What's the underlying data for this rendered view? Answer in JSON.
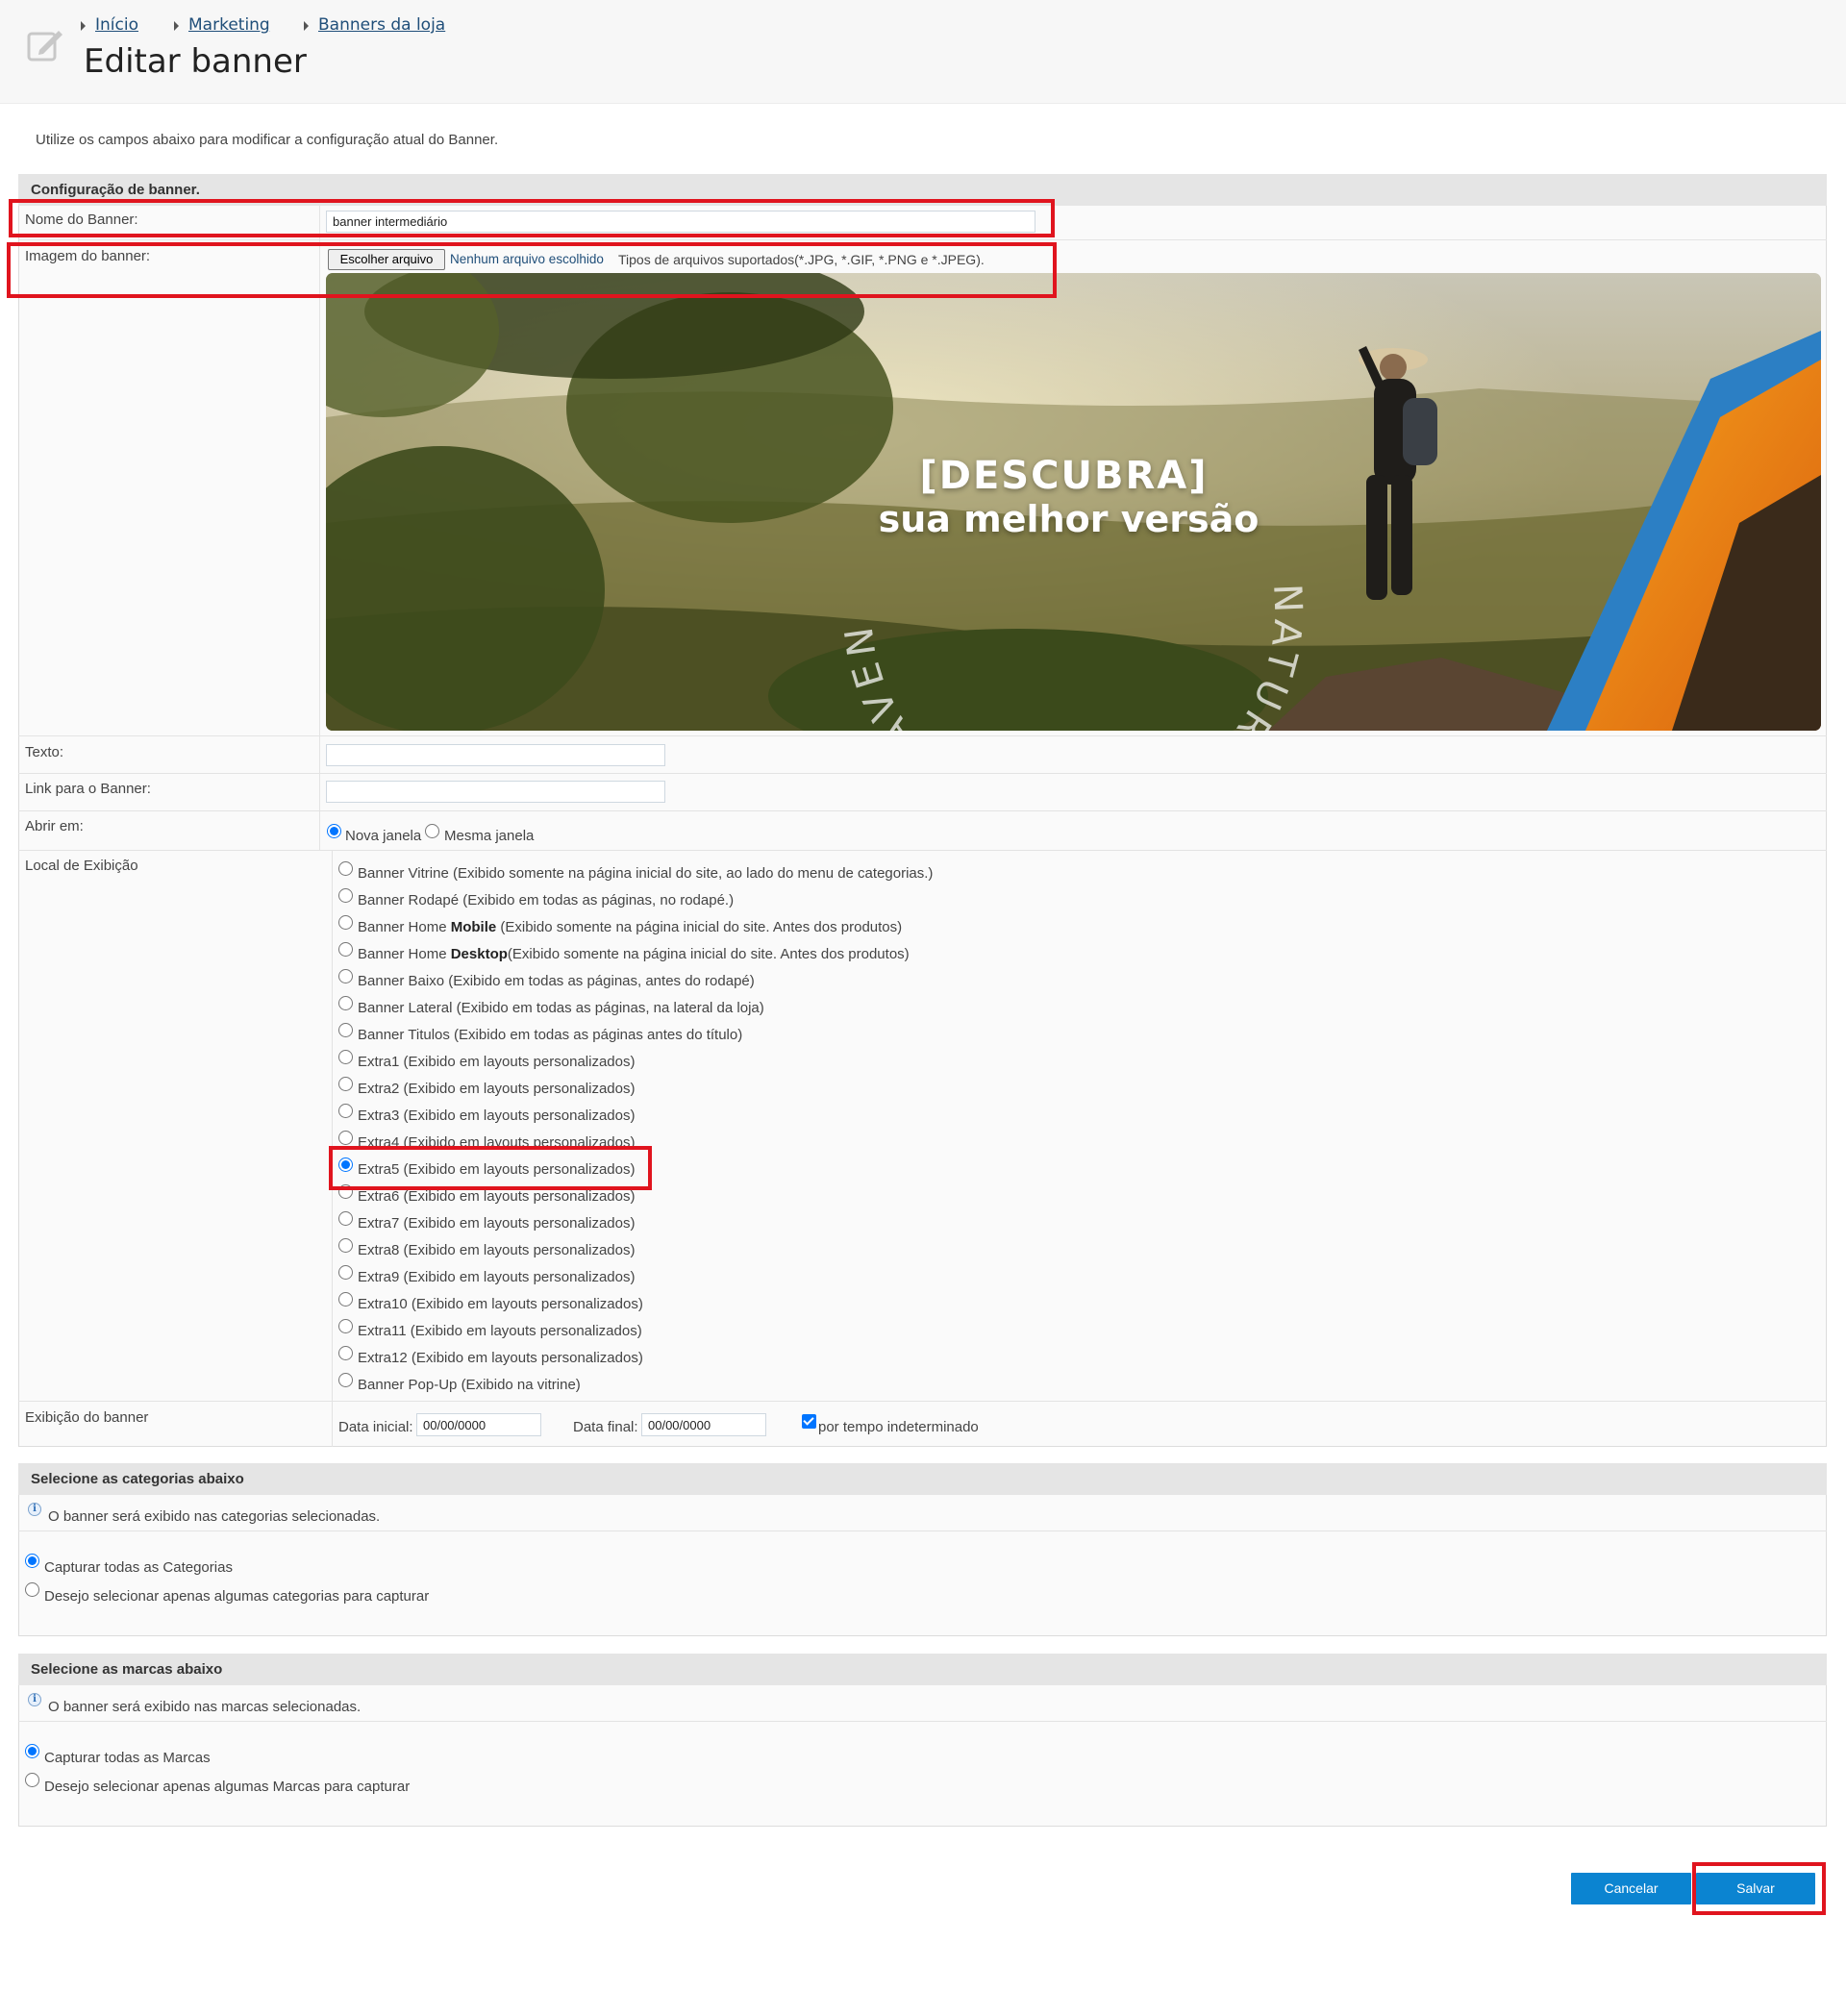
{
  "breadcrumb": [
    "Início",
    "Marketing",
    "Banners da loja"
  ],
  "page_title": "Editar banner",
  "intro": "Utilize os campos abaixo para modificar a configuração atual do Banner.",
  "config": {
    "header": "Configuração de banner.",
    "name_label": "Nome do Banner:",
    "name_value": "banner intermediário",
    "image_label": "Imagem do banner:",
    "file_button": "Escolher arquivo",
    "file_status": "Nenhum arquivo escolhido",
    "file_types": "Tipos de arquivos suportados(*.JPG, *.GIF, *.PNG e *.JPEG).",
    "banner": {
      "line1": "[DESCUBRA]",
      "line2": "sua melhor versão",
      "ring": "NATUREZA CONEXÃO AVENTURA LIBERDADE"
    },
    "text_label": "Texto:",
    "text_value": "",
    "link_label": "Link para o Banner:",
    "link_value": "",
    "open_label": "Abrir em:",
    "open_options": [
      "Nova janela",
      "Mesma janela"
    ],
    "open_selected": "Nova janela",
    "location_label": "Local de Exibição",
    "locations": [
      {
        "pre": "Banner Vitrine (Exibido somente na página inicial do site, ao lado do menu de categorias.)",
        "bold": "",
        "post": ""
      },
      {
        "pre": "Banner Rodapé (Exibido em todas as páginas, no rodapé.)",
        "bold": "",
        "post": ""
      },
      {
        "pre": "Banner Home ",
        "bold": "Mobile",
        "post": " (Exibido somente na página inicial do site. Antes dos produtos)"
      },
      {
        "pre": "Banner Home ",
        "bold": "Desktop",
        "post": "(Exibido somente na página inicial do site. Antes dos produtos)"
      },
      {
        "pre": "Banner Baixo (Exibido em todas as páginas, antes do rodapé)",
        "bold": "",
        "post": ""
      },
      {
        "pre": "Banner Lateral (Exibido em todas as páginas, na lateral da loja)",
        "bold": "",
        "post": ""
      },
      {
        "pre": "Banner Titulos (Exibido em todas as páginas antes do título)",
        "bold": "",
        "post": ""
      },
      {
        "pre": "Extra1 (Exibido em layouts personalizados)",
        "bold": "",
        "post": ""
      },
      {
        "pre": "Extra2 (Exibido em layouts personalizados)",
        "bold": "",
        "post": ""
      },
      {
        "pre": "Extra3 (Exibido em layouts personalizados)",
        "bold": "",
        "post": ""
      },
      {
        "pre": "Extra4 (Exibido em layouts personalizados)",
        "bold": "",
        "post": ""
      },
      {
        "pre": "Extra5 (Exibido em layouts personalizados)",
        "bold": "",
        "post": ""
      },
      {
        "pre": "Extra6 (Exibido em layouts personalizados)",
        "bold": "",
        "post": ""
      },
      {
        "pre": "Extra7 (Exibido em layouts personalizados)",
        "bold": "",
        "post": ""
      },
      {
        "pre": "Extra8 (Exibido em layouts personalizados)",
        "bold": "",
        "post": ""
      },
      {
        "pre": "Extra9 (Exibido em layouts personalizados)",
        "bold": "",
        "post": ""
      },
      {
        "pre": "Extra10 (Exibido em layouts personalizados)",
        "bold": "",
        "post": ""
      },
      {
        "pre": "Extra11 (Exibido em layouts personalizados)",
        "bold": "",
        "post": ""
      },
      {
        "pre": "Extra12 (Exibido em layouts personalizados)",
        "bold": "",
        "post": ""
      },
      {
        "pre": "Banner Pop-Up (Exibido na vitrine)",
        "bold": "",
        "post": ""
      }
    ],
    "location_selected": "Extra5 (Exibido em layouts personalizados)",
    "display_label": "Exibição do banner",
    "start_label": "Data inicial:",
    "start_value": "00/00/0000",
    "end_label": "Data final:",
    "end_value": "00/00/0000",
    "indefinite_label": "por tempo indeterminado",
    "indefinite_checked": true
  },
  "categories": {
    "header": "Selecione as categorias abaixo",
    "info": "O banner será exibido nas categorias selecionadas.",
    "options": [
      "Capturar todas as Categorias",
      "Desejo selecionar apenas algumas categorias para capturar"
    ],
    "selected": "Capturar todas as Categorias"
  },
  "brands": {
    "header": "Selecione as marcas abaixo",
    "info": "O banner será exibido nas marcas selecionadas.",
    "options": [
      "Capturar todas as Marcas",
      "Desejo selecionar apenas algumas Marcas para capturar"
    ],
    "selected": "Capturar todas as Marcas"
  },
  "actions": {
    "cancel": "Cancelar",
    "save": "Salvar"
  },
  "colors": {
    "accent": "#0b84d1",
    "highlight": "#e0141e",
    "radio_selected": "#0075ff"
  }
}
